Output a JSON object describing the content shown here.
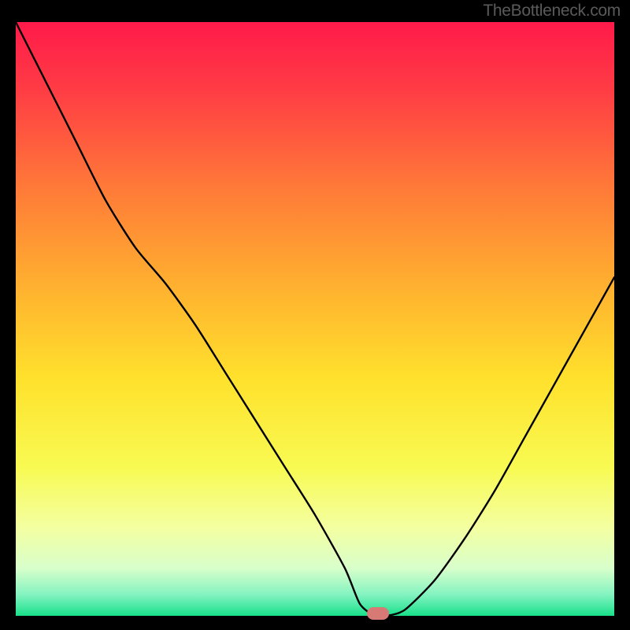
{
  "attribution": "TheBottleneck.com",
  "chart_data": {
    "type": "line",
    "title": "",
    "xlabel": "",
    "ylabel": "",
    "x": [
      0.0,
      0.05,
      0.1,
      0.15,
      0.2,
      0.25,
      0.3,
      0.35,
      0.4,
      0.45,
      0.5,
      0.55,
      0.575,
      0.6,
      0.62,
      0.65,
      0.7,
      0.75,
      0.8,
      0.85,
      0.9,
      0.95,
      1.0
    ],
    "values": [
      1.0,
      0.9,
      0.8,
      0.7,
      0.62,
      0.56,
      0.49,
      0.41,
      0.33,
      0.25,
      0.17,
      0.08,
      0.02,
      0.0,
      0.0,
      0.01,
      0.06,
      0.13,
      0.21,
      0.3,
      0.39,
      0.48,
      0.57
    ],
    "xlim": [
      0,
      1
    ],
    "ylim": [
      0,
      1
    ],
    "marker": {
      "x": 0.605,
      "y": 0.0
    },
    "background_gradient": {
      "stops": [
        {
          "offset": 0.0,
          "color": "#ff1a4a"
        },
        {
          "offset": 0.12,
          "color": "#ff3e44"
        },
        {
          "offset": 0.28,
          "color": "#ff7a38"
        },
        {
          "offset": 0.45,
          "color": "#ffb22f"
        },
        {
          "offset": 0.6,
          "color": "#ffe12c"
        },
        {
          "offset": 0.75,
          "color": "#f8fa52"
        },
        {
          "offset": 0.85,
          "color": "#f4ffa0"
        },
        {
          "offset": 0.92,
          "color": "#d8ffcb"
        },
        {
          "offset": 0.965,
          "color": "#82f3c0"
        },
        {
          "offset": 1.0,
          "color": "#18e08a"
        }
      ]
    }
  }
}
